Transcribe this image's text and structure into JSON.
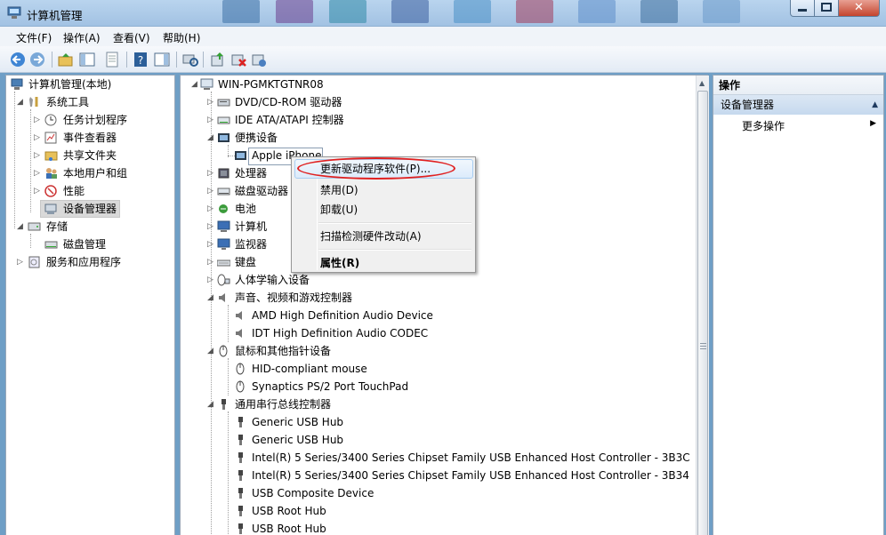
{
  "window": {
    "title": "计算机管理"
  },
  "menu": [
    "文件(F)",
    "操作(A)",
    "查看(V)",
    "帮助(H)"
  ],
  "toolbar": {
    "buttons": [
      "back-icon",
      "forward-icon",
      "up-folder-icon",
      "show-hide-tree-icon",
      "export-list-icon",
      "help-icon",
      "show-hide-action-pane-icon",
      "scan-hardware-icon",
      "update-driver-icon",
      "disable-device-icon",
      "uninstall-device-icon"
    ]
  },
  "left_tree": {
    "root": "计算机管理(本地)",
    "system_tools": "系统工具",
    "task_scheduler": "任务计划程序",
    "event_viewer": "事件查看器",
    "shared_folders": "共享文件夹",
    "local_users": "本地用户和组",
    "performance": "性能",
    "device_manager": "设备管理器",
    "storage": "存储",
    "disk_management": "磁盘管理",
    "services_apps": "服务和应用程序"
  },
  "device_tree": {
    "computer_name": "WIN-PGMKTGTNR08",
    "dvd": "DVD/CD-ROM 驱动器",
    "ide": "IDE ATA/ATAPI 控制器",
    "portable": "便携设备",
    "apple_iphone": "Apple iPhone",
    "processor": "处理器",
    "disk_drives": "磁盘驱动器",
    "battery": "电池",
    "computer": "计算机",
    "monitors": "监视器",
    "keyboard": "键盘",
    "hid": "人体学输入设备",
    "sound": "声音、视频和游戏控制器",
    "amd_audio": "AMD High Definition Audio Device",
    "idt_audio": "IDT High Definition Audio CODEC",
    "mice": "鼠标和其他指针设备",
    "hid_mouse": "HID-compliant mouse",
    "touchpad": "Synaptics PS/2 Port TouchPad",
    "usb": "通用串行总线控制器",
    "usb_hub_1": "Generic USB Hub",
    "usb_hub_2": "Generic USB Hub",
    "intel_3b3c": "Intel(R) 5 Series/3400 Series Chipset Family USB Enhanced Host Controller - 3B3C",
    "intel_3b34": "Intel(R) 5 Series/3400 Series Chipset Family USB Enhanced Host Controller - 3B34",
    "usb_composite": "USB Composite Device",
    "usb_root_1": "USB Root Hub",
    "usb_root_2": "USB Root Hub"
  },
  "context_menu": {
    "update_driver": "更新驱动程序软件(P)...",
    "disable": "禁用(D)",
    "uninstall": "卸载(U)",
    "scan": "扫描检测硬件改动(A)",
    "properties": "属性(R)"
  },
  "actions": {
    "header": "操作",
    "group": "设备管理器",
    "more": "更多操作"
  }
}
